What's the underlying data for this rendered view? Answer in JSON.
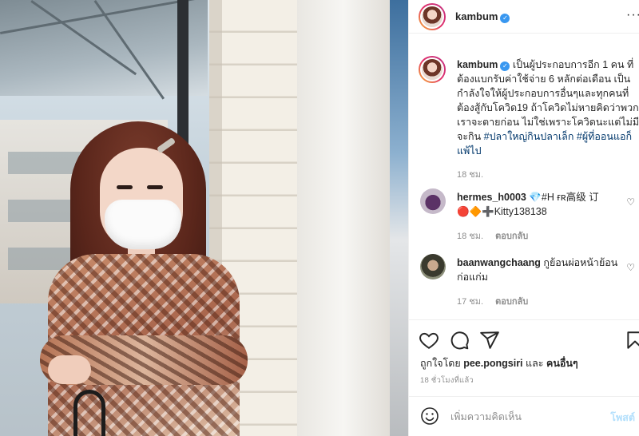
{
  "post": {
    "username": "kambum",
    "caption_user": "kambum",
    "caption_text": "เป็นผู้ประกอบการอีก 1 คน ที่ต้องแบกรับค่าใช้จ่าย 6 หลักต่อเดือน เป็นกำลังใจให้ผู้ประกอบการอื่นๆและทุกคนที่ต้องสู้กับโควิด19 ถ้าโควิดไม่หายคิดว่าพวกเราจะตายก่อน ไม่ใช่เพราะโควิดนะแต่ไม่มีจะกิน ",
    "caption_tags": "#ปลาใหญ่กินปลาเล็ก #ผู้ที่ออนแอก็แพ้ไป",
    "caption_time": "18 ชม."
  },
  "comments": [
    {
      "username": "hermes_h0003",
      "text": "💎#H ғʀ高级 订 🔴🔶➕Kitty138138",
      "time": "18 ชม.",
      "reply": "ตอบกลับ"
    },
    {
      "username": "baanwangchaang",
      "text": "กูย้อนผ่อหน้าย้อนก่อแก่ม",
      "time": "17 ชม.",
      "reply": "ตอบกลับ"
    }
  ],
  "likes": {
    "prefix": "ถูกใจโดย",
    "user": "pee.pongsiri",
    "conj": "และ",
    "others": "คนอื่นๆ"
  },
  "timestamp": "18 ชั่วโมงที่แล้ว",
  "add_comment": {
    "placeholder": "เพิ่มความคิดเห็น",
    "post_label": "โพสต์"
  },
  "colors": {
    "verified": "#3897f0",
    "link": "#00376b",
    "muted": "#8e8e8e",
    "post_disabled": "#b2dffc"
  },
  "icons": [
    "verified-badge-icon",
    "more-options-icon",
    "heart-icon",
    "comment-icon",
    "share-icon",
    "bookmark-icon",
    "emoji-icon",
    "small-heart-icon"
  ]
}
